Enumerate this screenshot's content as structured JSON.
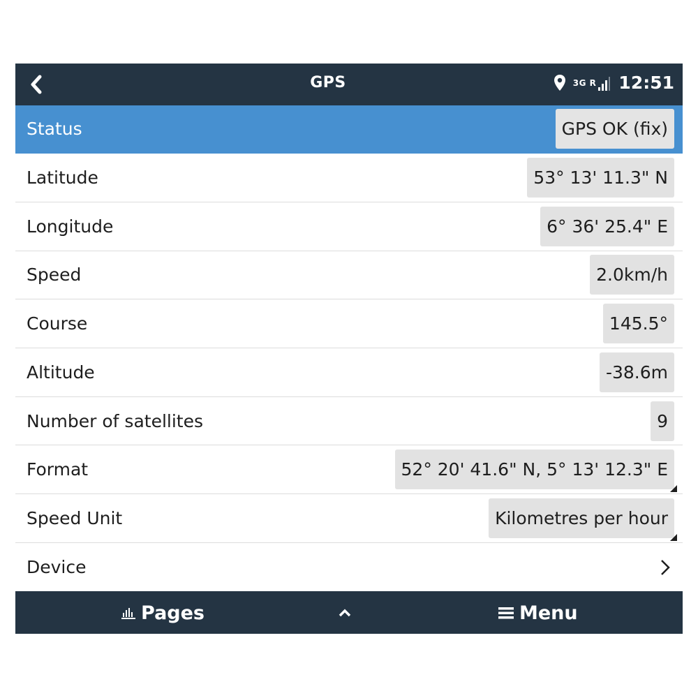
{
  "header": {
    "title": "GPS",
    "network": "3G R",
    "time": "12:51",
    "icons": [
      "back-chevron-icon",
      "location-pin-icon",
      "signal-bars-icon"
    ]
  },
  "rows": [
    {
      "label": "Status",
      "value": "GPS OK (fix)"
    },
    {
      "label": "Latitude",
      "value": "53° 13' 11.3\" N"
    },
    {
      "label": "Longitude",
      "value": "6° 36' 25.4\" E"
    },
    {
      "label": "Speed",
      "value": "2.0km/h"
    },
    {
      "label": "Course",
      "value": "145.5°"
    },
    {
      "label": "Altitude",
      "value": "-38.6m"
    },
    {
      "label": "Number of satellites",
      "value": "9"
    },
    {
      "label": "Format",
      "value": "52° 20' 41.6\" N, 5° 13' 12.3\" E"
    },
    {
      "label": "Speed Unit",
      "value": "Kilometres per hour"
    },
    {
      "label": "Device"
    }
  ],
  "footer": {
    "pages_label": "Pages",
    "menu_label": "Menu"
  },
  "colors": {
    "bar": "#243443",
    "selected": "#4790d0",
    "value_bg": "#e2e2e2"
  }
}
